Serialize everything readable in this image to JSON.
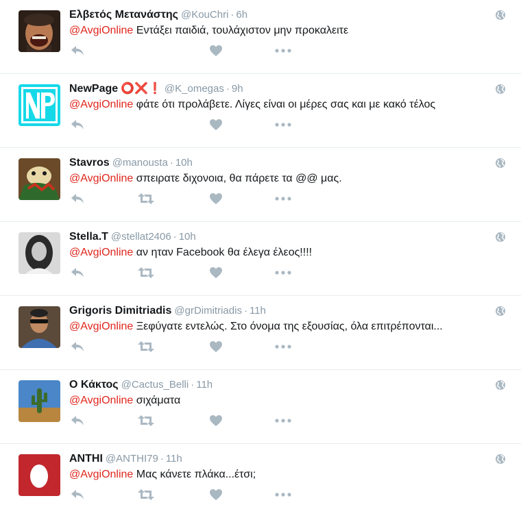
{
  "colors": {
    "mention": "#e0261d",
    "meta": "#8899a6",
    "icon": "#aab8c2",
    "divider": "#e6ecf0"
  },
  "tweets": [
    {
      "name": "Ελβετός Μετανάστης",
      "handle": "@KouChri",
      "time": "6h",
      "mention": "@AvgiOnline",
      "text": " Εντάξει παιδιά, τουλάχιστον μην προκαλειτε",
      "avatar_icon": "laughing-man-avatar",
      "retweet_visible": false
    },
    {
      "name": "NewPage",
      "name_extra": "⭕❌❗",
      "handle": "@K_omegas",
      "time": "9h",
      "mention": "@AvgiOnline",
      "text": " φάτε ότι προλάβετε. Λίγες είναι οι μέρες σας και με κακό τέλος",
      "avatar_icon": "np-logo-avatar",
      "retweet_visible": false
    },
    {
      "name": "Stavros",
      "handle": "@manousta",
      "time": "10h",
      "mention": "@AvgiOnline",
      "text": " σπειρατε διχονοια, θα πάρετε τα @@ μας.",
      "avatar_icon": "plush-toy-avatar",
      "retweet_visible": true
    },
    {
      "name": "Stella.T",
      "handle": "@stellat2406",
      "time": "10h",
      "mention": "@AvgiOnline",
      "text": " αν ηταν Facebook θα έλεγα έλεος!!!!",
      "avatar_icon": "woman-portrait-avatar",
      "retweet_visible": true
    },
    {
      "name": "Grigoris Dimitriadis",
      "handle": "@grDimitriadis",
      "time": "11h",
      "mention": "@AvgiOnline",
      "text": " Ξεφύγατε εντελώς. Στο όνομα της εξουσίας, όλα επιτρέπονται...",
      "avatar_icon": "man-sunglasses-avatar",
      "retweet_visible": true
    },
    {
      "name": "Ο Κάκτος",
      "handle": "@Cactus_Belli",
      "time": "11h",
      "mention": "@AvgiOnline",
      "text": " σιχάματα",
      "avatar_icon": "cactus-landscape-avatar",
      "retweet_visible": true
    },
    {
      "name": "ANTHI",
      "handle": "@ANTHI79",
      "time": "11h",
      "mention": "@AvgiOnline",
      "text": " Μας κάνετε πλάκα...έτσι;",
      "avatar_icon": "egg-default-avatar",
      "retweet_visible": true
    }
  ]
}
